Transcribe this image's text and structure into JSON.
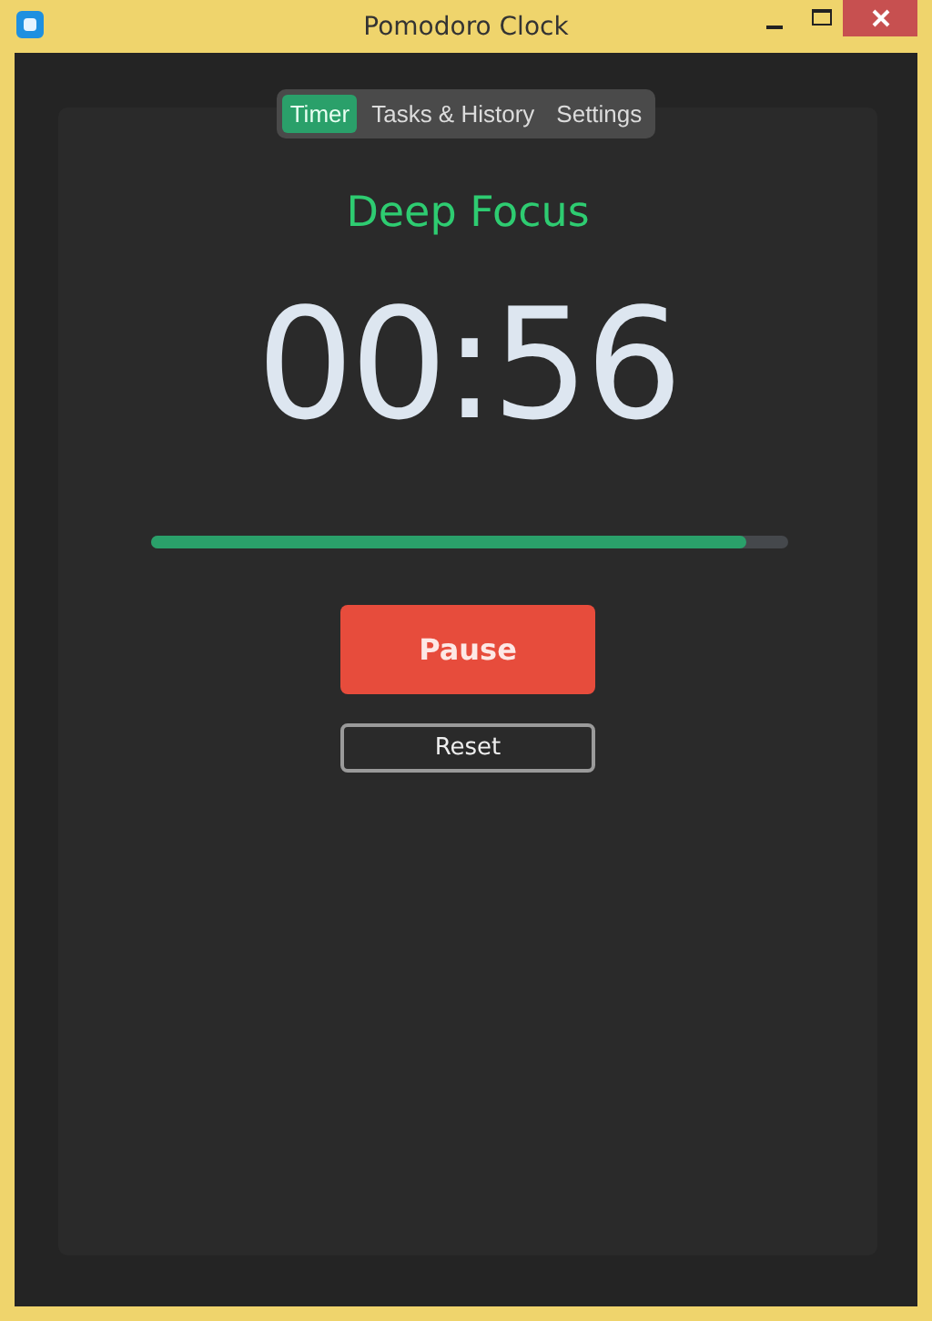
{
  "window": {
    "title": "Pomodoro Clock"
  },
  "tabs": [
    {
      "label": "Timer",
      "selected": true
    },
    {
      "label": "Tasks & History",
      "selected": false
    },
    {
      "label": "Settings",
      "selected": false
    }
  ],
  "session": {
    "label": "Deep Focus"
  },
  "timer": {
    "time": "00:56"
  },
  "progress": {
    "level": 0.934
  },
  "buttons": [
    {
      "label": "Pause",
      "kind": "primary"
    },
    {
      "label": "Reset",
      "kind": "outline"
    }
  ]
}
